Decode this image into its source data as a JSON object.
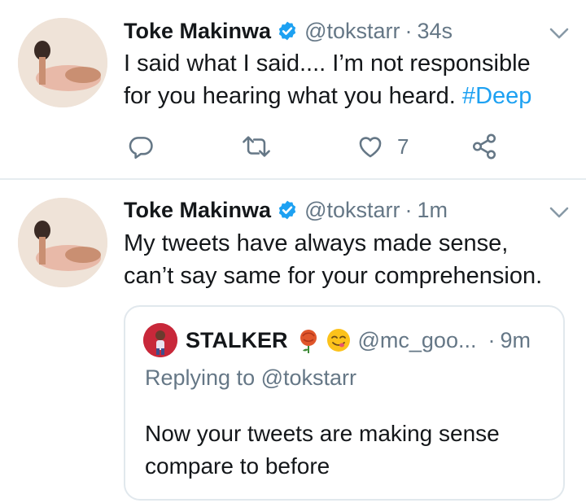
{
  "colors": {
    "accent": "#1da1f2",
    "verified": "#1da1f2",
    "secondary_text": "#657786",
    "divider": "#e6ecf0"
  },
  "icons": {
    "verified": "verified-badge-icon",
    "menu": "chevron-down-icon",
    "reply": "reply-icon",
    "retweet": "retweet-icon",
    "like": "heart-icon",
    "share": "share-icon"
  },
  "tweets": [
    {
      "name": "Toke Makinwa",
      "handle": "@tokstarr",
      "separator": "·",
      "time": "34s",
      "body_lines": [
        "I said what I said.... I’m not responsible",
        "for you hearing what you heard. "
      ],
      "hashtag": "#Deep",
      "like_count": "7"
    },
    {
      "name": "Toke Makinwa",
      "handle": "@tokstarr",
      "separator": "·",
      "time": "1m",
      "body_lines": [
        "My tweets have always made sense,",
        "can’t say same for your comprehension."
      ],
      "quoted": {
        "name": "STALKER",
        "handle": "@mc_goo...",
        "separator": "·",
        "time": "9m",
        "replying_label": "Replying to",
        "replying_handle": "@tokstarr",
        "body_lines": [
          "Now your tweets are making sense",
          "compare to before"
        ]
      }
    }
  ]
}
